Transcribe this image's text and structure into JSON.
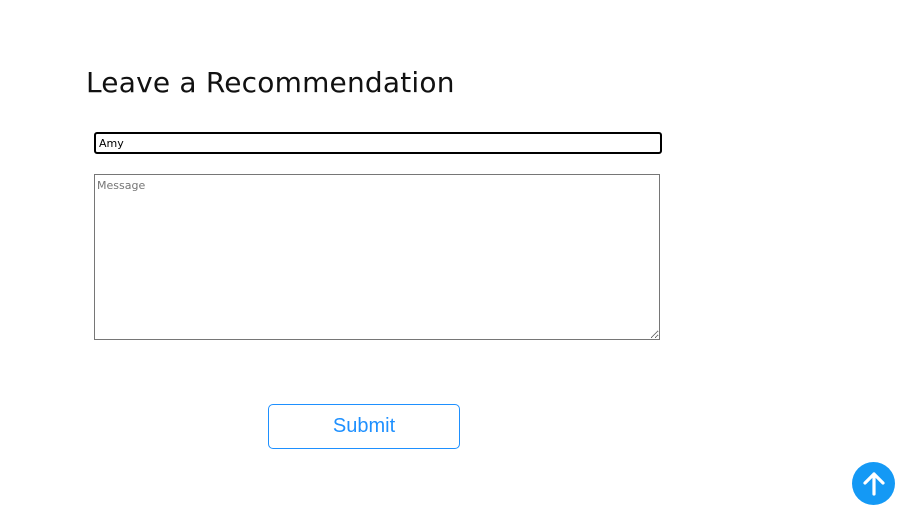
{
  "form": {
    "title": "Leave a Recommendation",
    "name_value": "Amy",
    "message_placeholder": "Message",
    "message_value": "",
    "submit_label": "Submit"
  },
  "scroll_top": {
    "icon": "arrow-up-icon",
    "color": "#1499f5"
  },
  "colors": {
    "accent": "#1e90ff",
    "text": "#111111"
  }
}
